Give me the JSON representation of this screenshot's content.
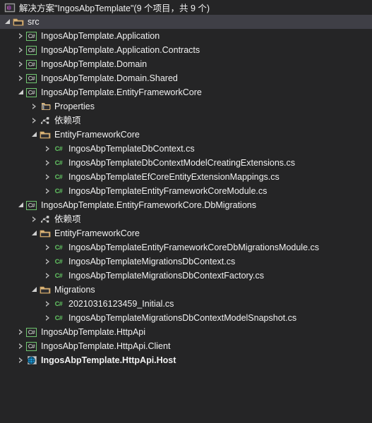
{
  "window": {
    "background": "#252526",
    "highlight": "#3f3f46",
    "text_color": "#f1f1f1",
    "csharp_green": "#64c864",
    "folder_orange": "#dcb67a"
  },
  "solution_header": {
    "icon": "visual-studio-solution-icon",
    "title": "解决方案\"IngosAbpTemplate\"(9 个项目，共 9 个)"
  },
  "tree": {
    "rows": [
      {
        "label": "src",
        "icon": "folder-icon",
        "expander": "expanded",
        "indent": 1,
        "highlight": true,
        "bold": false
      },
      {
        "label": "IngosAbpTemplate.Application",
        "icon": "csharp-project-icon",
        "expander": "collapsed",
        "indent": 2,
        "highlight": false,
        "bold": false
      },
      {
        "label": "IngosAbpTemplate.Application.Contracts",
        "icon": "csharp-project-icon",
        "expander": "collapsed",
        "indent": 2,
        "highlight": false,
        "bold": false
      },
      {
        "label": "IngosAbpTemplate.Domain",
        "icon": "csharp-project-icon",
        "expander": "collapsed",
        "indent": 2,
        "highlight": false,
        "bold": false
      },
      {
        "label": "IngosAbpTemplate.Domain.Shared",
        "icon": "csharp-project-icon",
        "expander": "collapsed",
        "indent": 2,
        "highlight": false,
        "bold": false
      },
      {
        "label": "IngosAbpTemplate.EntityFrameworkCore",
        "icon": "csharp-project-icon",
        "expander": "expanded",
        "indent": 2,
        "highlight": false,
        "bold": false
      },
      {
        "label": "Properties",
        "icon": "properties-folder-icon",
        "expander": "collapsed",
        "indent": 3,
        "highlight": false,
        "bold": false
      },
      {
        "label": "依赖项",
        "icon": "dependencies-icon",
        "expander": "collapsed",
        "indent": 3,
        "highlight": false,
        "bold": false
      },
      {
        "label": "EntityFrameworkCore",
        "icon": "folder-icon",
        "expander": "expanded",
        "indent": 3,
        "highlight": false,
        "bold": false
      },
      {
        "label": "IngosAbpTemplateDbContext.cs",
        "icon": "csharp-file-icon",
        "expander": "collapsed",
        "indent": 4,
        "highlight": false,
        "bold": false
      },
      {
        "label": "IngosAbpTemplateDbContextModelCreatingExtensions.cs",
        "icon": "csharp-file-icon",
        "expander": "collapsed",
        "indent": 4,
        "highlight": false,
        "bold": false
      },
      {
        "label": "IngosAbpTemplateEfCoreEntityExtensionMappings.cs",
        "icon": "csharp-file-icon",
        "expander": "collapsed",
        "indent": 4,
        "highlight": false,
        "bold": false
      },
      {
        "label": "IngosAbpTemplateEntityFrameworkCoreModule.cs",
        "icon": "csharp-file-icon",
        "expander": "collapsed",
        "indent": 4,
        "highlight": false,
        "bold": false
      },
      {
        "label": "IngosAbpTemplate.EntityFrameworkCore.DbMigrations",
        "icon": "csharp-project-icon",
        "expander": "expanded",
        "indent": 2,
        "highlight": false,
        "bold": false
      },
      {
        "label": "依赖项",
        "icon": "dependencies-icon",
        "expander": "collapsed",
        "indent": 3,
        "highlight": false,
        "bold": false
      },
      {
        "label": "EntityFrameworkCore",
        "icon": "folder-icon",
        "expander": "expanded",
        "indent": 3,
        "highlight": false,
        "bold": false
      },
      {
        "label": "IngosAbpTemplateEntityFrameworkCoreDbMigrationsModule.cs",
        "icon": "csharp-file-icon",
        "expander": "collapsed",
        "indent": 4,
        "highlight": false,
        "bold": false
      },
      {
        "label": "IngosAbpTemplateMigrationsDbContext.cs",
        "icon": "csharp-file-icon",
        "expander": "collapsed",
        "indent": 4,
        "highlight": false,
        "bold": false
      },
      {
        "label": "IngosAbpTemplateMigrationsDbContextFactory.cs",
        "icon": "csharp-file-icon",
        "expander": "collapsed",
        "indent": 4,
        "highlight": false,
        "bold": false
      },
      {
        "label": "Migrations",
        "icon": "folder-icon",
        "expander": "expanded",
        "indent": 3,
        "highlight": false,
        "bold": false
      },
      {
        "label": "20210316123459_Initial.cs",
        "icon": "csharp-file-icon",
        "expander": "collapsed",
        "indent": 4,
        "highlight": false,
        "bold": false
      },
      {
        "label": "IngosAbpTemplateMigrationsDbContextModelSnapshot.cs",
        "icon": "csharp-file-icon",
        "expander": "collapsed",
        "indent": 4,
        "highlight": false,
        "bold": false
      },
      {
        "label": "IngosAbpTemplate.HttpApi",
        "icon": "csharp-project-icon",
        "expander": "collapsed",
        "indent": 2,
        "highlight": false,
        "bold": false
      },
      {
        "label": "IngosAbpTemplate.HttpApi.Client",
        "icon": "csharp-project-icon",
        "expander": "collapsed",
        "indent": 2,
        "highlight": false,
        "bold": false
      },
      {
        "label": "IngosAbpTemplate.HttpApi.Host",
        "icon": "web-project-icon",
        "expander": "collapsed",
        "indent": 2,
        "highlight": false,
        "bold": true
      }
    ]
  }
}
